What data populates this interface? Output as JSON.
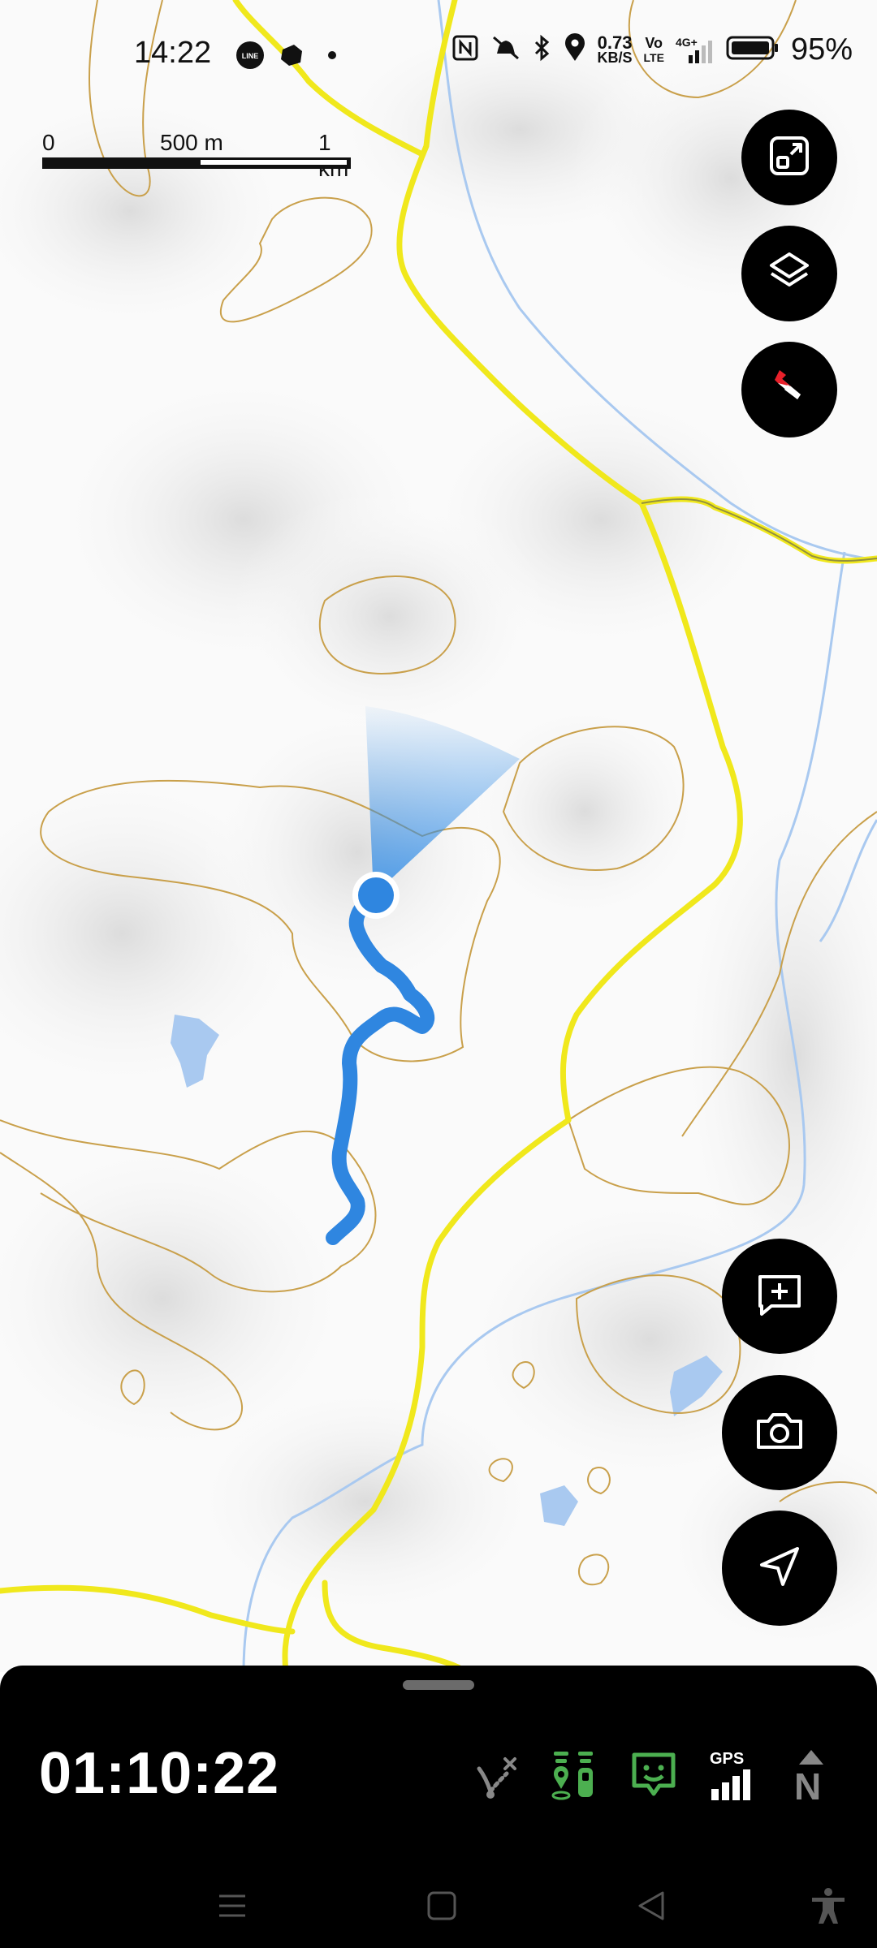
{
  "status_bar": {
    "time": "14:22",
    "network_speed_value": "0.73",
    "network_speed_unit": "KB/S",
    "volte_top": "Vo",
    "volte_bottom": "LTE",
    "mobile_network": "4G+",
    "battery_percent": "95%",
    "icons": [
      "line-icon",
      "app-notification-icon",
      "dot-icon",
      "nfc-icon",
      "mute-icon",
      "bluetooth-icon",
      "location-icon",
      "signal-icon",
      "battery-icon"
    ]
  },
  "scale_bar": {
    "label_start": "0",
    "label_mid": "500 m",
    "label_end": "1 km"
  },
  "map": {
    "layer_buttons": [
      "fit-view-icon",
      "layers-icon",
      "compass-icon"
    ],
    "action_buttons": [
      "add-waypoint-icon",
      "camera-icon",
      "navigate-icon"
    ],
    "colors": {
      "road": "#f0e81c",
      "track": "#2f86e0",
      "contour": "#c9a04b",
      "water": "#a9c9f0"
    }
  },
  "bottom_panel": {
    "elapsed_time": "01:10:22",
    "gps_label": "GPS",
    "north_label": "N",
    "status_icons": [
      "route-off-icon",
      "waypoint-track-icon",
      "message-icon",
      "gps-signal-icon",
      "north-up-icon"
    ],
    "accent_color": "#4caf50"
  },
  "nav_bar": {
    "icons": [
      "menu-icon",
      "home-icon",
      "back-icon",
      "accessibility-icon"
    ]
  }
}
